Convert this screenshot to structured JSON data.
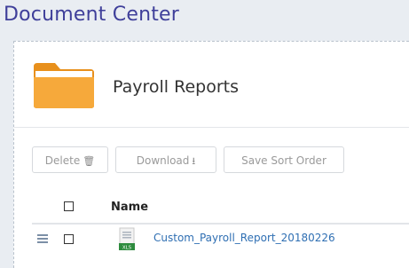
{
  "header": {
    "title": "Document Center"
  },
  "folder": {
    "name": "Payroll Reports",
    "icon": "folder-icon",
    "color": "#f5a623"
  },
  "toolbar": {
    "delete_label": "Delete",
    "delete_icon": "trash-icon",
    "download_label": "Download",
    "download_icon": "download-icon",
    "save_sort_label": "Save Sort Order"
  },
  "list": {
    "column_name": "Name",
    "rows": [
      {
        "name": "Custom_Payroll_Report_20180226",
        "file_type": "XLS",
        "icon": "excel-file-icon",
        "checked": false
      }
    ]
  },
  "colors": {
    "title": "#3f3f9a",
    "link": "#2f6fb3",
    "xls_badge": "#2e8b3e"
  }
}
